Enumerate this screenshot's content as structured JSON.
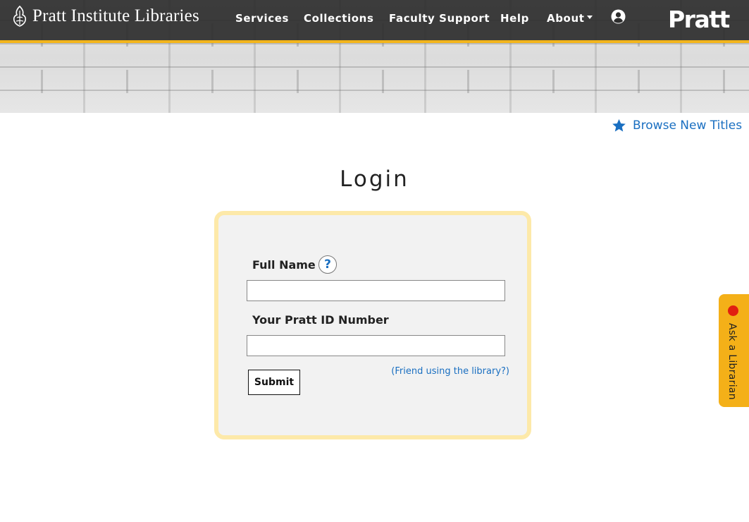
{
  "header": {
    "brand_text": "Pratt Institute Libraries",
    "nav": {
      "services": "Services",
      "collections": "Collections",
      "faculty_support": "Faculty Support",
      "help": "Help",
      "about": "About"
    },
    "pratt_logo": "Pratt",
    "accent_color": "#f2b51c"
  },
  "browse_link": "Browse New Titles",
  "login": {
    "title": "Login",
    "full_name_label": "Full Name",
    "help_symbol": "?",
    "full_name_value": "",
    "id_label": "Your Pratt ID Number",
    "id_value": "",
    "friend_link": "(Friend using the library?)",
    "submit_label": "Submit"
  },
  "ask_tab": {
    "label": "Ask a Librarian",
    "status_color": "#e11f10"
  }
}
